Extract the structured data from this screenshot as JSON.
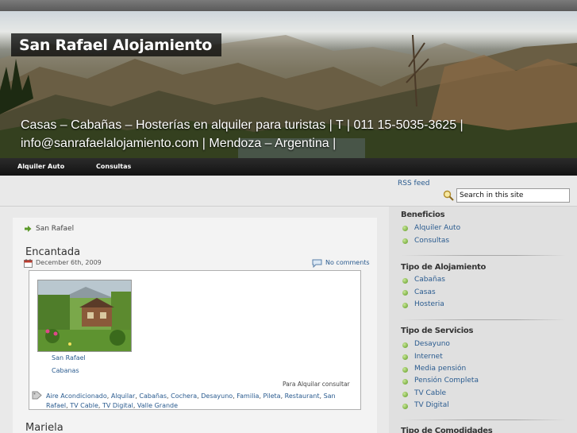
{
  "header": {
    "site_title": "San Rafael Alojamiento",
    "tagline": "Casas – Cabañas – Hosterías en alquiler para turistas | T | 011 15-5035-3625 | info@sanrafaelalojamiento.com | Mendoza – Argentina |"
  },
  "nav": {
    "items": [
      "Alquiler Auto",
      "Consultas"
    ]
  },
  "top": {
    "rss_label": "RSS feed",
    "search_placeholder": "Search in this site"
  },
  "content": {
    "breadcrumb": "San Rafael",
    "post": {
      "title": "Encantada",
      "date": "December 6th, 2009",
      "comments": "No comments",
      "caption_line1": "San Rafael",
      "caption_line2": "Cabanas",
      "rent_text": "Para Alquilar consultar",
      "tags": [
        "Aire Acondicionado",
        "Alquilar",
        "Cabañas",
        "Cochera",
        "Desayuno",
        "Familia",
        "Pileta",
        "Restaurant",
        "San Rafael",
        "TV Cable",
        "TV Digital",
        "Valle Grande"
      ]
    },
    "next_post_title": "Mariela"
  },
  "sidebar": {
    "sections": [
      {
        "heading": "Beneficios",
        "items": [
          "Alquiler Auto",
          "Consultas"
        ]
      },
      {
        "heading": "Tipo de Alojamiento",
        "items": [
          "Cabañas",
          "Casas",
          "Hosteria"
        ]
      },
      {
        "heading": "Tipo de Servicios",
        "items": [
          "Desayuno",
          "Internet",
          "Media pensión",
          "Pensión Completa",
          "TV Cable",
          "TV Digital"
        ]
      },
      {
        "heading": "Tipo de Comodidades",
        "items": []
      }
    ]
  },
  "colors": {
    "link": "#2a5b8f",
    "nav_bg": "#1e1e1e",
    "bullet": "#5d9a20"
  },
  "icons": {
    "breadcrumb": "arrow-right-icon",
    "date": "calendar-icon",
    "comments": "comment-bubble-icon",
    "tags": "tag-icon",
    "search": "magnifier-icon",
    "list_bullet": "green-dot-icon"
  }
}
